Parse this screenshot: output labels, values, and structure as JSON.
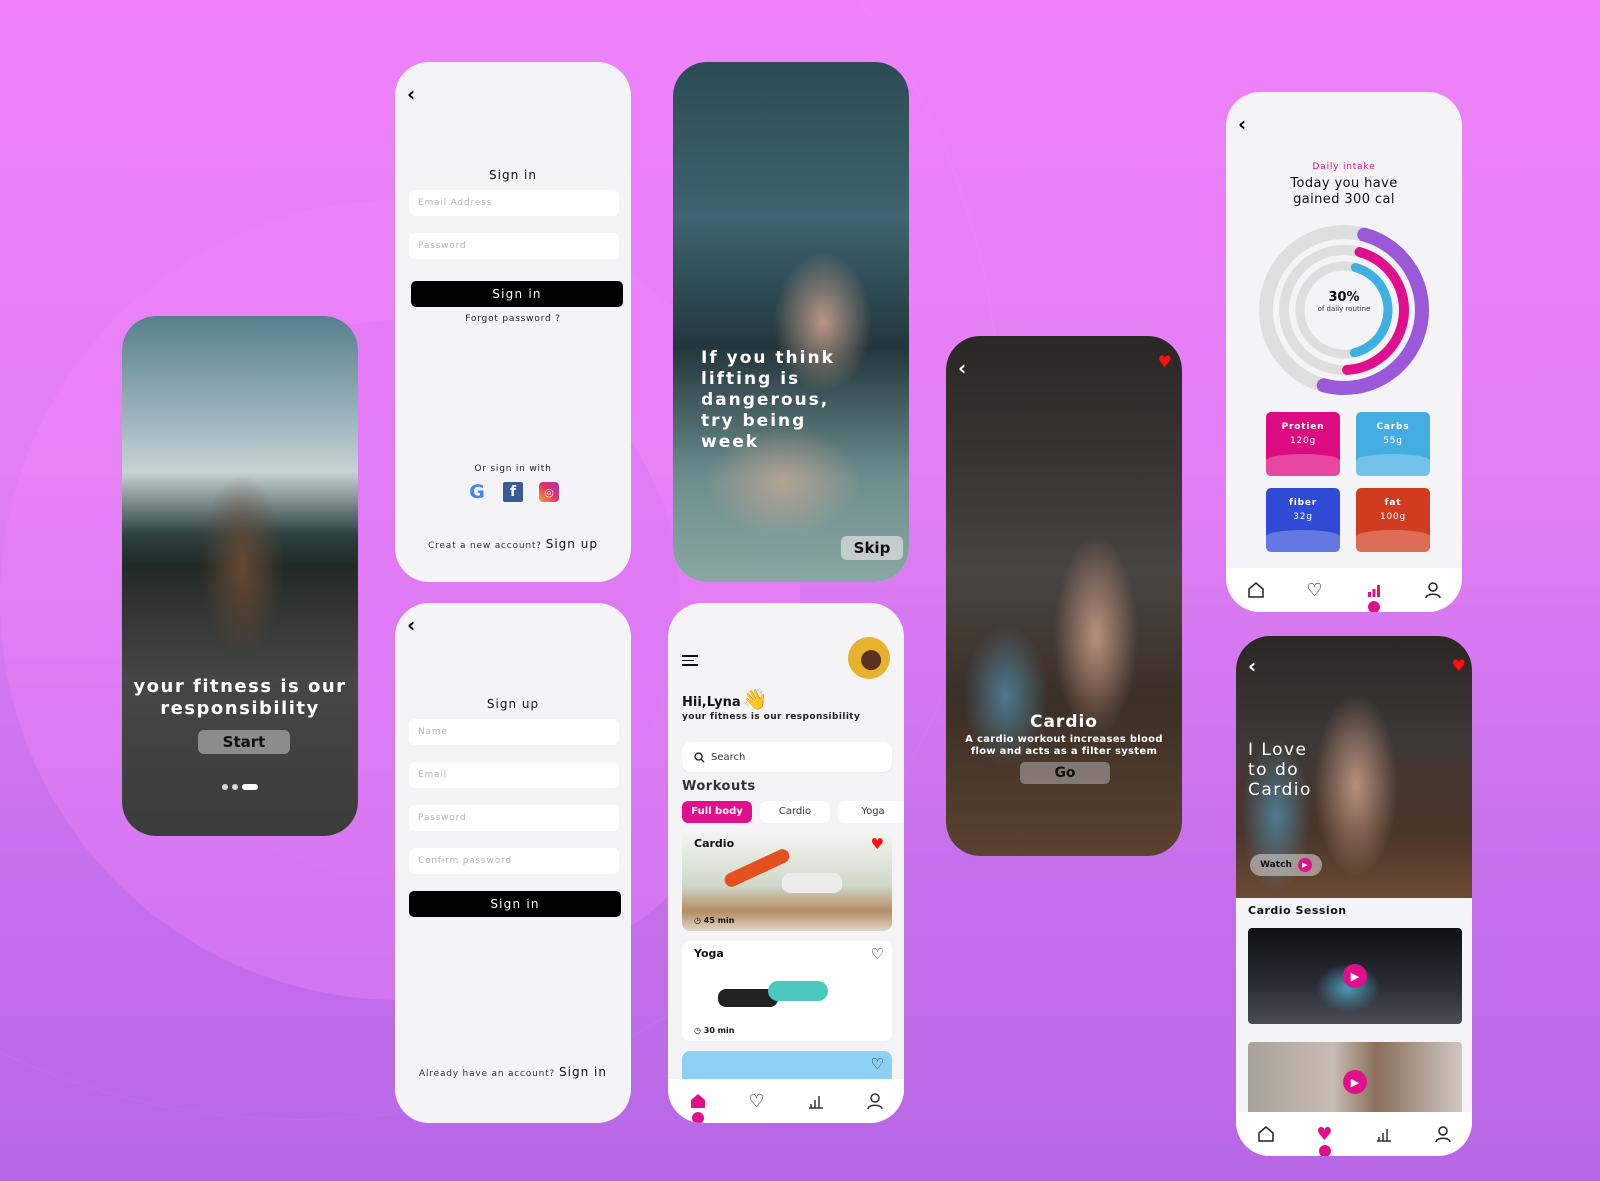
{
  "theme": {
    "accent": "#e0108d",
    "background_top": "#ef82fb",
    "background_bottom": "#b767e6",
    "heart_red": "#ff1010"
  },
  "onboarding": {
    "title": "your fitness is our responsibility",
    "start_label": "Start",
    "pager": {
      "count": 3,
      "active_index": 2
    }
  },
  "signin": {
    "back_icon": "chevron-left-icon",
    "title": "Sign in",
    "email_placeholder": "Email Address",
    "password_placeholder": "Password",
    "button_label": "Sign in",
    "forgot_label": "Forgot password ?",
    "social_label": "Or sign in with",
    "social": [
      {
        "name": "google",
        "glyph": "G"
      },
      {
        "name": "facebook",
        "glyph": "f"
      },
      {
        "name": "instagram",
        "glyph": "◎"
      }
    ],
    "create_text": "Creat a new account?",
    "create_link": "Sign up"
  },
  "signup": {
    "back_icon": "chevron-left-icon",
    "title": "Sign up",
    "name_placeholder": "Name",
    "email_placeholder": "Email",
    "password_placeholder": "Password",
    "confirm_placeholder": "Confirm password",
    "button_label": "Sign in",
    "already_text": "Already have an account?",
    "already_link": "Sign in"
  },
  "motivation": {
    "quote_lines": [
      "If you think",
      "lifting is",
      "dangerous,",
      "try being",
      "week"
    ],
    "skip_label": "Skip"
  },
  "home": {
    "greeting": "Hii,Lyna",
    "wave_emoji": "👋",
    "tagline": "your fitness is our responsibility",
    "search_placeholder": "Search",
    "section_title": "Workouts",
    "chips": [
      {
        "label": "Full body",
        "active": true
      },
      {
        "label": "Cardio",
        "active": false
      },
      {
        "label": "Yoga",
        "active": false
      }
    ],
    "workouts": [
      {
        "title": "Cardio",
        "duration": "45 min",
        "favorited": true
      },
      {
        "title": "Yoga",
        "duration": "30 min",
        "favorited": false
      }
    ],
    "nav_active": "home"
  },
  "cardio_detail": {
    "title": "Cardio",
    "description_line1": "A cardio workout increases blood",
    "description_line2": "flow and acts as a filter system",
    "go_label": "Go",
    "favorited": true
  },
  "intake": {
    "label": "Daily intake",
    "title_line1": "Today you have",
    "title_line2": "gained 300 cal",
    "percent_label": "30%",
    "percent_sub": "of daily routine",
    "rings": [
      {
        "name": "outer",
        "color": "#9b59d9",
        "fraction": 0.5
      },
      {
        "name": "middle",
        "color": "#e0108d",
        "fraction": 0.45
      },
      {
        "name": "inner",
        "color": "#3fb0e4",
        "fraction": 0.42
      }
    ],
    "macros": [
      {
        "name": "Protien",
        "value": "120g",
        "color": "#dd0a82"
      },
      {
        "name": "Carbs",
        "value": "55g",
        "color": "#43ade2"
      },
      {
        "name": "fiber",
        "value": "32g",
        "color": "#2f4bd6"
      },
      {
        "name": "fat",
        "value": "100g",
        "color": "#d23c1e"
      }
    ],
    "nav_active": "stats"
  },
  "session": {
    "hero_title_lines": [
      "I Love",
      "to do",
      "Cardio"
    ],
    "watch_label": "Watch",
    "section_title": "Cardio Session",
    "videos": [
      {
        "name": "stability-ball-stretch"
      },
      {
        "name": "group-leg-kick"
      }
    ],
    "nav_active": "favorites"
  }
}
